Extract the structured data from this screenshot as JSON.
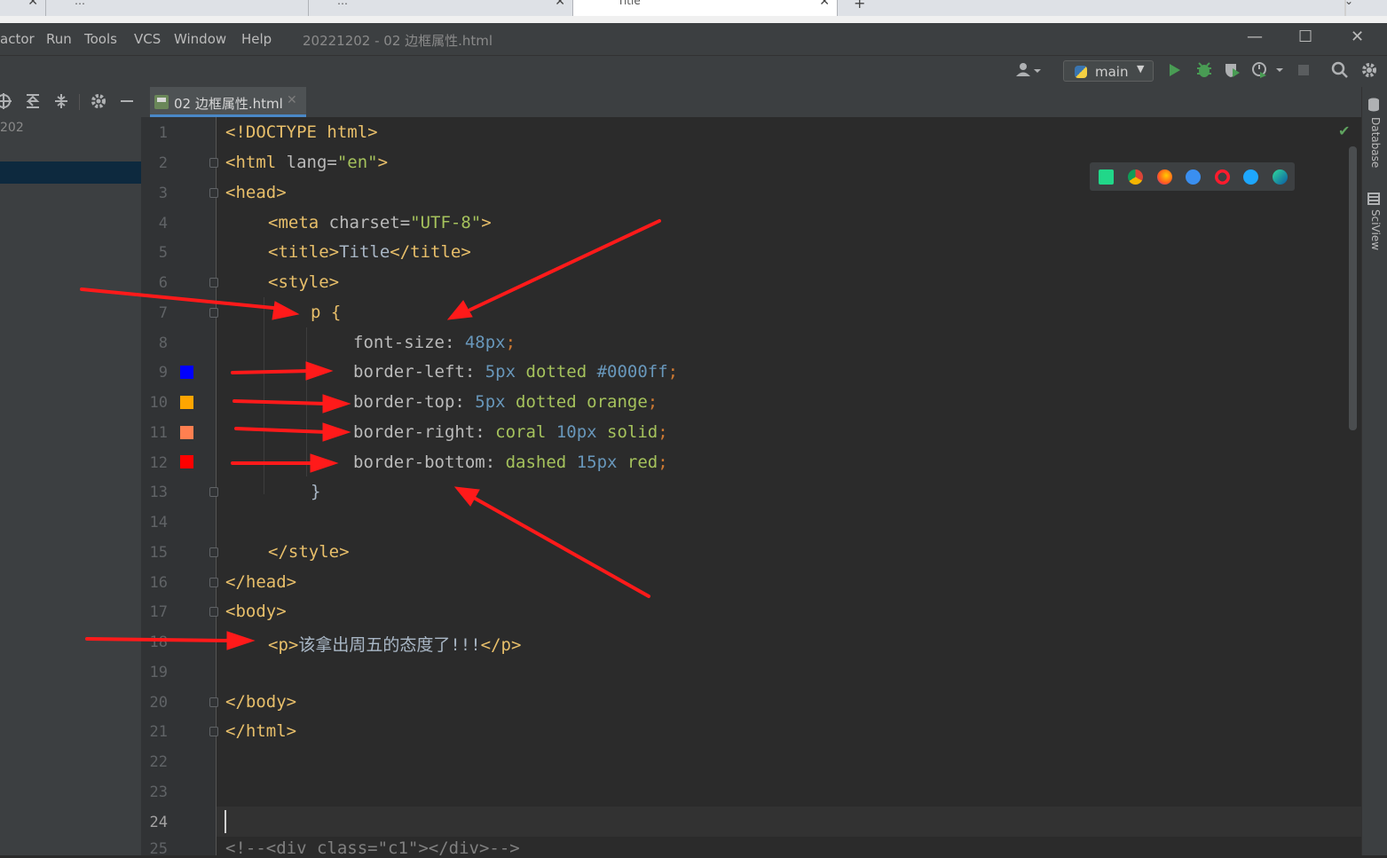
{
  "browser_tabs": {
    "tab1_text": "…",
    "tab2_text": "…",
    "tab3_text": "…",
    "tab4_text": "Title",
    "close_glyph": "✕",
    "new_tab_glyph": "+",
    "menu_glyph": "⌄"
  },
  "menubar": {
    "items": [
      "actor",
      "Run",
      "Tools",
      "VCS",
      "Window",
      "Help"
    ],
    "window_title": "20221202 - 02 边框属性.html",
    "minimize": "—",
    "maximize": "☐",
    "close": "✕"
  },
  "toolbar": {
    "run_config": "main",
    "dropdown_glyph": "▼",
    "icons": [
      "user-icon",
      "python-icon",
      "run-icon",
      "debug-icon",
      "coverage-icon",
      "profile-icon",
      "stop-icon",
      "search-icon",
      "settings-icon"
    ]
  },
  "project_panel": {
    "partial_text": "202"
  },
  "editor_tab": {
    "filename": "02 边框属性.html",
    "close": "✕"
  },
  "editor": {
    "current_line": 24,
    "line_numbers": [
      "1",
      "2",
      "3",
      "4",
      "5",
      "6",
      "7",
      "8",
      "9",
      "10",
      "11",
      "12",
      "13",
      "14",
      "15",
      "16",
      "17",
      "18",
      "19",
      "20",
      "21",
      "22",
      "23",
      "24",
      "25"
    ],
    "color_swatches": [
      {
        "line": 9,
        "color": "#0000ff"
      },
      {
        "line": 10,
        "color": "#ffa500"
      },
      {
        "line": 11,
        "color": "#ff7f50"
      },
      {
        "line": 12,
        "color": "#ff0000"
      }
    ],
    "code": {
      "l1a": "<!DOCTYPE html>",
      "l2a": "<html",
      "l2b": " lang",
      "l2c": "=",
      "l2d": "\"en\"",
      "l2e": ">",
      "l3a": "<head>",
      "l4a": "<meta",
      "l4b": " charset",
      "l4c": "=",
      "l4d": "\"UTF-8\"",
      "l4e": ">",
      "l5a": "<title>",
      "l5b": "Title",
      "l5c": "</title>",
      "l6a": "<style>",
      "l7a": "p {",
      "l8a": "font-size",
      "l8b": ": ",
      "l8c": "48px",
      "l8d": ";",
      "l9a": "border-left",
      "l9b": ": ",
      "l9c": "5px",
      "l9d": " dotted ",
      "l9e": "#0000ff",
      "l9f": ";",
      "l10a": "border-top",
      "l10b": ": ",
      "l10c": "5px",
      "l10d": " dotted ",
      "l10e": "orange",
      "l10f": ";",
      "l11a": "border-right",
      "l11b": ": ",
      "l11c": "coral ",
      "l11d": "10px",
      "l11e": " solid",
      "l11f": ";",
      "l12a": "border-bottom",
      "l12b": ": ",
      "l12c": "dashed ",
      "l12d": "15px",
      "l12e": " red",
      "l12f": ";",
      "l13a": "}",
      "l15a": "</style>",
      "l16a": "</head>",
      "l17a": "<body>",
      "l18a": "<p>",
      "l18b": "该拿出周五的态度了!!!",
      "l18c": "</p>",
      "l20a": "</body>",
      "l21a": "</html>",
      "l25a": "<!--<div class=\"c1\"></div>-->"
    }
  },
  "right_stripe": {
    "database_label": "Database",
    "sciview_label": "SciView"
  },
  "browser_popup": {
    "icons": [
      "pycharm-icon",
      "chrome-icon",
      "firefox-icon",
      "safari-icon",
      "opera-icon",
      "ie-icon",
      "edge-icon"
    ]
  },
  "colors": {
    "annotation_arrow": "#ff1a1a",
    "accent": "#4a88c7"
  }
}
